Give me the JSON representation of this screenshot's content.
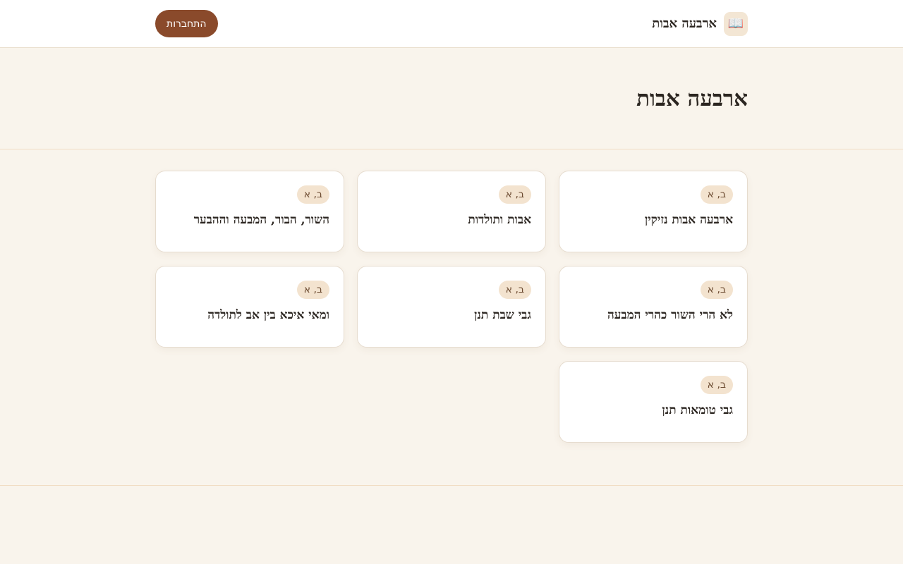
{
  "header": {
    "brand_icon": "open-book-icon",
    "brand_title": "ארבעה אבות",
    "login_label": "התחברות"
  },
  "hero": {
    "title": "ארבעה אבות"
  },
  "cards": [
    {
      "badge": "ב, א",
      "title": "ארבעה אבות נזיקין"
    },
    {
      "badge": "ב, א",
      "title": "אבות ותולדות"
    },
    {
      "badge": "ב, א",
      "title": "השור, הבור, המבעה וההבער"
    },
    {
      "badge": "ב, א",
      "title": "לא הרי השור כהרי המבעה"
    },
    {
      "badge": "ב, א",
      "title": "גבי שבת תנן"
    },
    {
      "badge": "ב, א",
      "title": "ומאי איכא בין אב לתולדה"
    },
    {
      "badge": "ב, א",
      "title": "גבי טומאות תנן"
    }
  ],
  "colors": {
    "background": "#f9f4ec",
    "accent": "#8a4a2b",
    "badge_bg": "#f3e3cf"
  }
}
